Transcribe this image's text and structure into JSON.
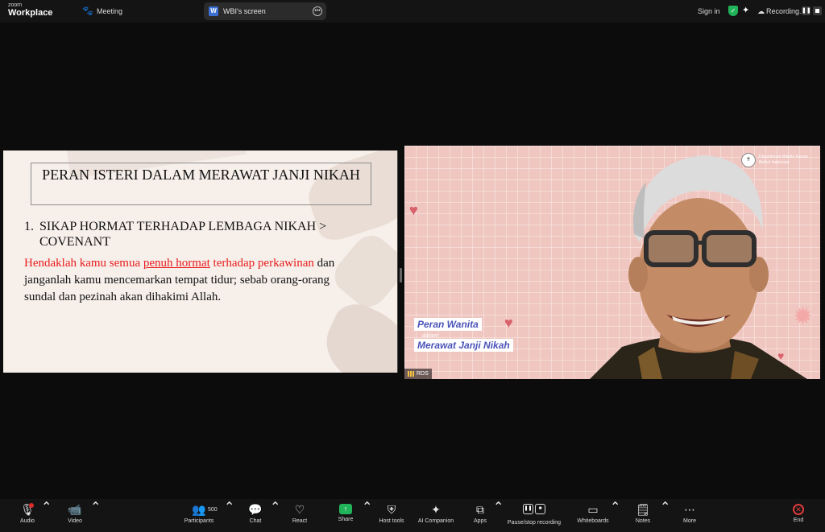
{
  "app": {
    "brand_small": "zoom",
    "brand_big": "Workplace",
    "meeting_label": "Meeting"
  },
  "screen_share": {
    "app_badge": "W",
    "label": "WBI's screen",
    "more_icon": "more-icon"
  },
  "top_right": {
    "sign_in": "Sign in",
    "recording_label": "Recording...",
    "secure_color": "#21b35a"
  },
  "slide": {
    "title": "PERAN ISTERI DALAM MERAWAT JANJI NIKAH",
    "point_number": "1.",
    "point_text": "SIKAP HORMAT TERHADAP LEMBAGA NIKAH > COVENANT",
    "verse_red_1": "Hendaklah kamu semua ",
    "verse_red_underline": "penuh hormat",
    "verse_red_2": " terhadap perkawinan",
    "verse_black": " dan janganlah kamu mencemarkan tempat tidur; sebab orang-orang sundal dan pezinah akan dihakimi Allah.",
    "accent_red": "#e81c1c"
  },
  "video": {
    "badge_text": "Departemen Wanita Gereja Bethel Indonesia",
    "lower_third_line1": "Peran Wanita",
    "lower_third_dalam": "dalam",
    "lower_third_line2": "Merawat Janji Nikah",
    "name_tag": "RDS",
    "accent_blue": "#4a53b8"
  },
  "toolbar": {
    "audio": "Audio",
    "video": "Video",
    "participants": "Participants",
    "participants_count": "500",
    "chat": "Chat",
    "react": "React",
    "share": "Share",
    "host_tools": "Host tools",
    "ai_companion": "AI Companion",
    "apps": "Apps",
    "pause_stop_recording": "Pause/stop recording",
    "whiteboards": "Whiteboards",
    "notes": "Notes",
    "more": "More",
    "end": "End"
  }
}
